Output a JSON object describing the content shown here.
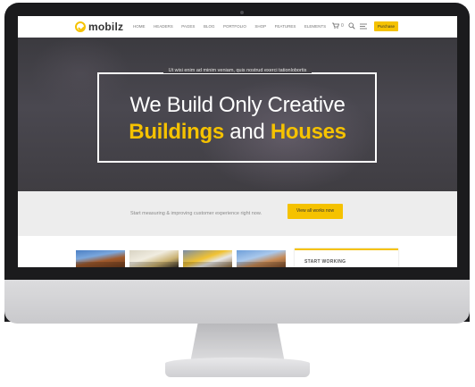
{
  "brand": {
    "name": "mobilz",
    "accent": "#f5c200"
  },
  "nav": {
    "items": [
      "HOME",
      "HEADERS",
      "PAGES",
      "BLOG",
      "PORTFOLIO",
      "SHOP",
      "FEATURES",
      "ELEMENTS"
    ],
    "cart_count": "0",
    "purchase_label": "Purchase"
  },
  "hero": {
    "subtitle": "Ut wisi enim ad minim veniam, quis nostrud exerci tationlobortis",
    "line1": "We Build Only Creative",
    "word_a": "Buildings",
    "joiner": "and",
    "word_b": "Houses"
  },
  "cta": {
    "text": "Start measuring & improving customer experience right now.",
    "button": "View all works now"
  },
  "sidebar_card": {
    "title": "START WORKING"
  },
  "icons": [
    "cart-icon",
    "search-icon",
    "menu-lines-icon",
    "logo-icon"
  ]
}
